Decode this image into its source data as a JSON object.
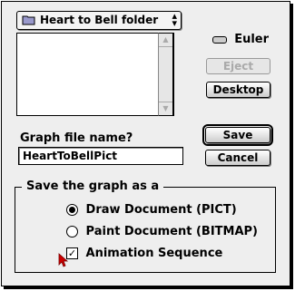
{
  "folder_popup": {
    "label": "Heart to Bell folder",
    "arrows": "⌃⌄"
  },
  "volume": {
    "name": "Euler"
  },
  "buttons": {
    "eject": "Eject",
    "desktop": "Desktop",
    "save": "Save",
    "cancel": "Cancel"
  },
  "filename": {
    "label": "Graph file name?",
    "value": "HeartToBellPict"
  },
  "save_as": {
    "title": "Save the graph as a",
    "options": [
      {
        "label": "Draw Document (PICT)",
        "type": "radio",
        "selected": true
      },
      {
        "label": "Paint Document (BITMAP)",
        "type": "radio",
        "selected": false
      },
      {
        "label": "Animation Sequence",
        "type": "checkbox",
        "checked": true
      }
    ]
  },
  "colors": {
    "accent_pointer": "#cc0000"
  },
  "icons": [
    "folder-icon",
    "disk-icon",
    "mouse-pointer-icon"
  ]
}
